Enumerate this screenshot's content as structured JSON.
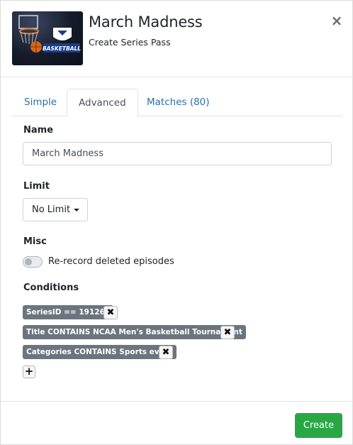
{
  "header": {
    "title": "March Madness",
    "subtitle": "Create Series Pass",
    "close_glyph": "×",
    "thumbnail_text": "BASKETBALL"
  },
  "tabs": [
    {
      "label": "Simple",
      "active": false
    },
    {
      "label": "Advanced",
      "active": true
    },
    {
      "label": "Matches (80)",
      "active": false
    }
  ],
  "form": {
    "name_label": "Name",
    "name_value": "March Madness",
    "limit_label": "Limit",
    "limit_value": "No Limit",
    "misc_label": "Misc",
    "rerecord_label": "Re-record deleted episodes",
    "rerecord_on": false,
    "conditions_label": "Conditions",
    "conditions": [
      {
        "text": "SeriesID == 191260"
      },
      {
        "text": "Title CONTAINS NCAA Men's Basketball Tournament"
      },
      {
        "text": "Categories CONTAINS Sports event"
      }
    ],
    "remove_glyph": "✖",
    "add_glyph": "+"
  },
  "footer": {
    "create_label": "Create"
  },
  "colors": {
    "accent_link": "#2a6fa8",
    "create_green": "#28a745",
    "chip_gray": "#6c757d"
  }
}
